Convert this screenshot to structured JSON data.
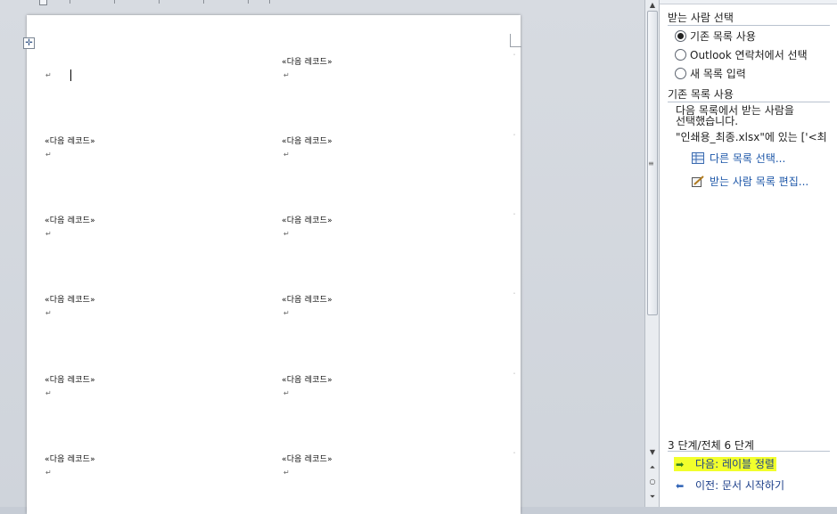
{
  "document": {
    "labels": [
      [
        "",
        "«다음 레코드»"
      ],
      [
        "«다음 레코드»",
        "«다음 레코드»"
      ],
      [
        "«다음 레코드»",
        "«다음 레코드»"
      ],
      [
        "«다음 레코드»",
        "«다음 레코드»"
      ],
      [
        "«다음 레코드»",
        "«다음 레코드»"
      ],
      [
        "«다음 레코드»",
        "«다음 레코드»"
      ]
    ]
  },
  "pane": {
    "select_recipients_title": "받는 사람 선택",
    "options": [
      {
        "label": "기존 목록 사용",
        "checked": true
      },
      {
        "label": "Outlook 연락처에서 선택",
        "checked": false
      },
      {
        "label": "새 목록 입력",
        "checked": false
      }
    ],
    "existing_list_title": "기존 목록 사용",
    "description_line1": "다음 목록에서 받는 사람을",
    "description_line2": "선택했습니다.",
    "source_info": "\"인쇄용_최종.xlsx\"에 있는 ['<최",
    "select_other_list_link": "다른 목록 선택...",
    "edit_list_link": "받는 사람 목록 편집...",
    "step_label": "3 단계/전체 6 단계",
    "next_link": "다음: 레이블 정렬",
    "prev_link": "이전: 문서 시작하기"
  },
  "colors": {
    "link": "#1c56a8",
    "highlight": "#f2ff2c"
  }
}
